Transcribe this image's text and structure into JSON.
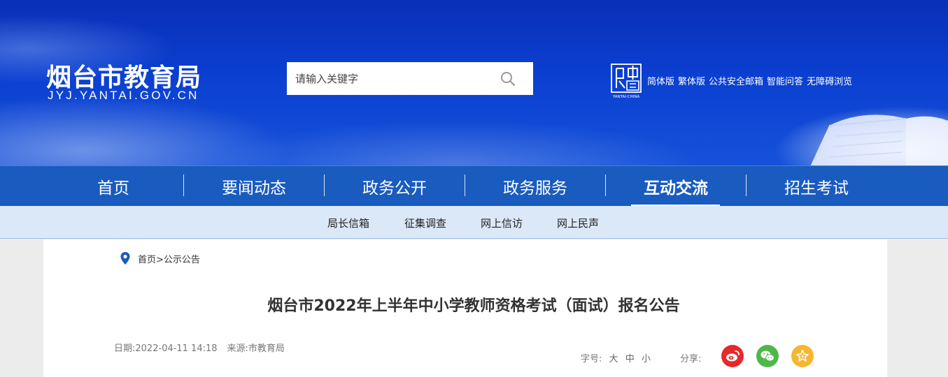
{
  "header": {
    "title": "烟台市教育局",
    "subtitle": "JYJ.YANTAI.GOV.CN",
    "search": {
      "placeholder": "请输入关键字"
    },
    "seal": {
      "caption": "YANTAI·CHINA"
    },
    "links": [
      "简体版",
      "繁体版",
      "公共安全邮箱",
      "智能问答",
      "无障碍浏览"
    ]
  },
  "nav": {
    "items": [
      "首页",
      "要闻动态",
      "政务公开",
      "政务服务",
      "互动交流",
      "招生考试"
    ],
    "active": "互动交流"
  },
  "subnav": {
    "items": [
      "局长信箱",
      "征集调查",
      "网上信访",
      "网上民声"
    ]
  },
  "breadcrumb": {
    "home": "首页",
    "separator": ">",
    "current": "公示公告"
  },
  "article": {
    "title": "烟台市2022年上半年中小学教师资格考试（面试）报名公告",
    "date": "日期:2022-04-11 14:18",
    "source": "来源:市教育局",
    "fontsize_label": "字号:",
    "fontsize_options": [
      "大",
      "中",
      "小"
    ],
    "share_label": "分享:"
  },
  "colors": {
    "nav_bg": "#1a5bbf",
    "subnav_bg": "#dbe8f8",
    "weibo": "#e6282c",
    "wechat": "#4cb848",
    "favorite": "#f5b731"
  }
}
